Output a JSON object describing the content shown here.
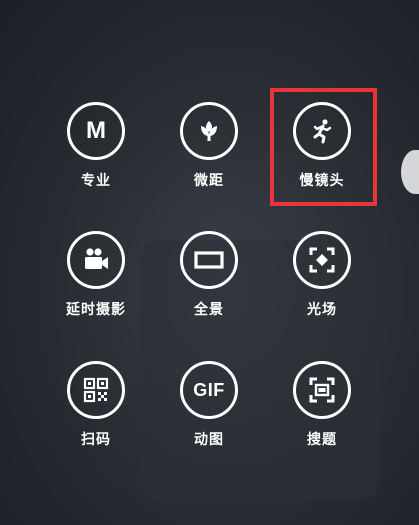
{
  "modes": [
    {
      "label": "专业",
      "icon": "m-letter-icon",
      "icon_text": "M"
    },
    {
      "label": "微距",
      "icon": "flower-icon"
    },
    {
      "label": "慢镜头",
      "icon": "running-person-icon"
    },
    {
      "label": "延时摄影",
      "icon": "video-camera-icon"
    },
    {
      "label": "全景",
      "icon": "panorama-rectangle-icon"
    },
    {
      "label": "光场",
      "icon": "focus-frame-icon"
    },
    {
      "label": "扫码",
      "icon": "qr-code-icon"
    },
    {
      "label": "动图",
      "icon": "gif-icon",
      "icon_text": "GIF"
    },
    {
      "label": "搜题",
      "icon": "scan-frame-icon"
    }
  ],
  "highlight": {
    "target": "慢镜头",
    "color": "#e8353b"
  },
  "colors": {
    "icon_stroke": "#ffffff",
    "background": "#2a2e35"
  }
}
